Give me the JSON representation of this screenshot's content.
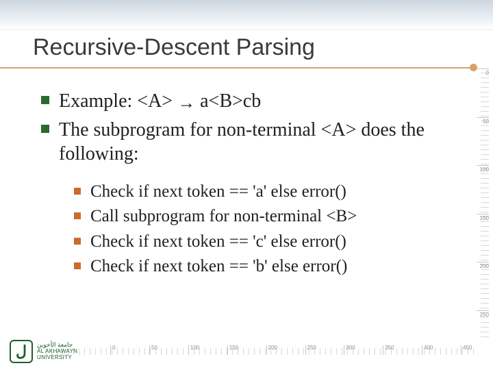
{
  "title": "Recursive-Descent Parsing",
  "bullets": {
    "item1_pre": "Example: <A> ",
    "item1_arrow": "→",
    "item1_post": " a<B>cb",
    "item2": "The subprogram for non-terminal <A> does the following:"
  },
  "sub": {
    "s1": "Check if next token == 'a' else error()",
    "s2": "Call subprogram for non-terminal <B>",
    "s3": "Check if next token == 'c' else error()",
    "s4": "Check if next token == 'b' else error()"
  },
  "logo": {
    "mark": "ل",
    "line1_ar": "جامعة الأخوين",
    "line2_en": "AL AKHAWAYN",
    "line3_en": "UNIVERSITY"
  },
  "ruler": {
    "v": [
      "0",
      "50",
      "100",
      "150",
      "200",
      "250"
    ],
    "h": [
      "0",
      "50",
      "100",
      "150",
      "200",
      "250",
      "300",
      "350",
      "400",
      "450"
    ]
  }
}
